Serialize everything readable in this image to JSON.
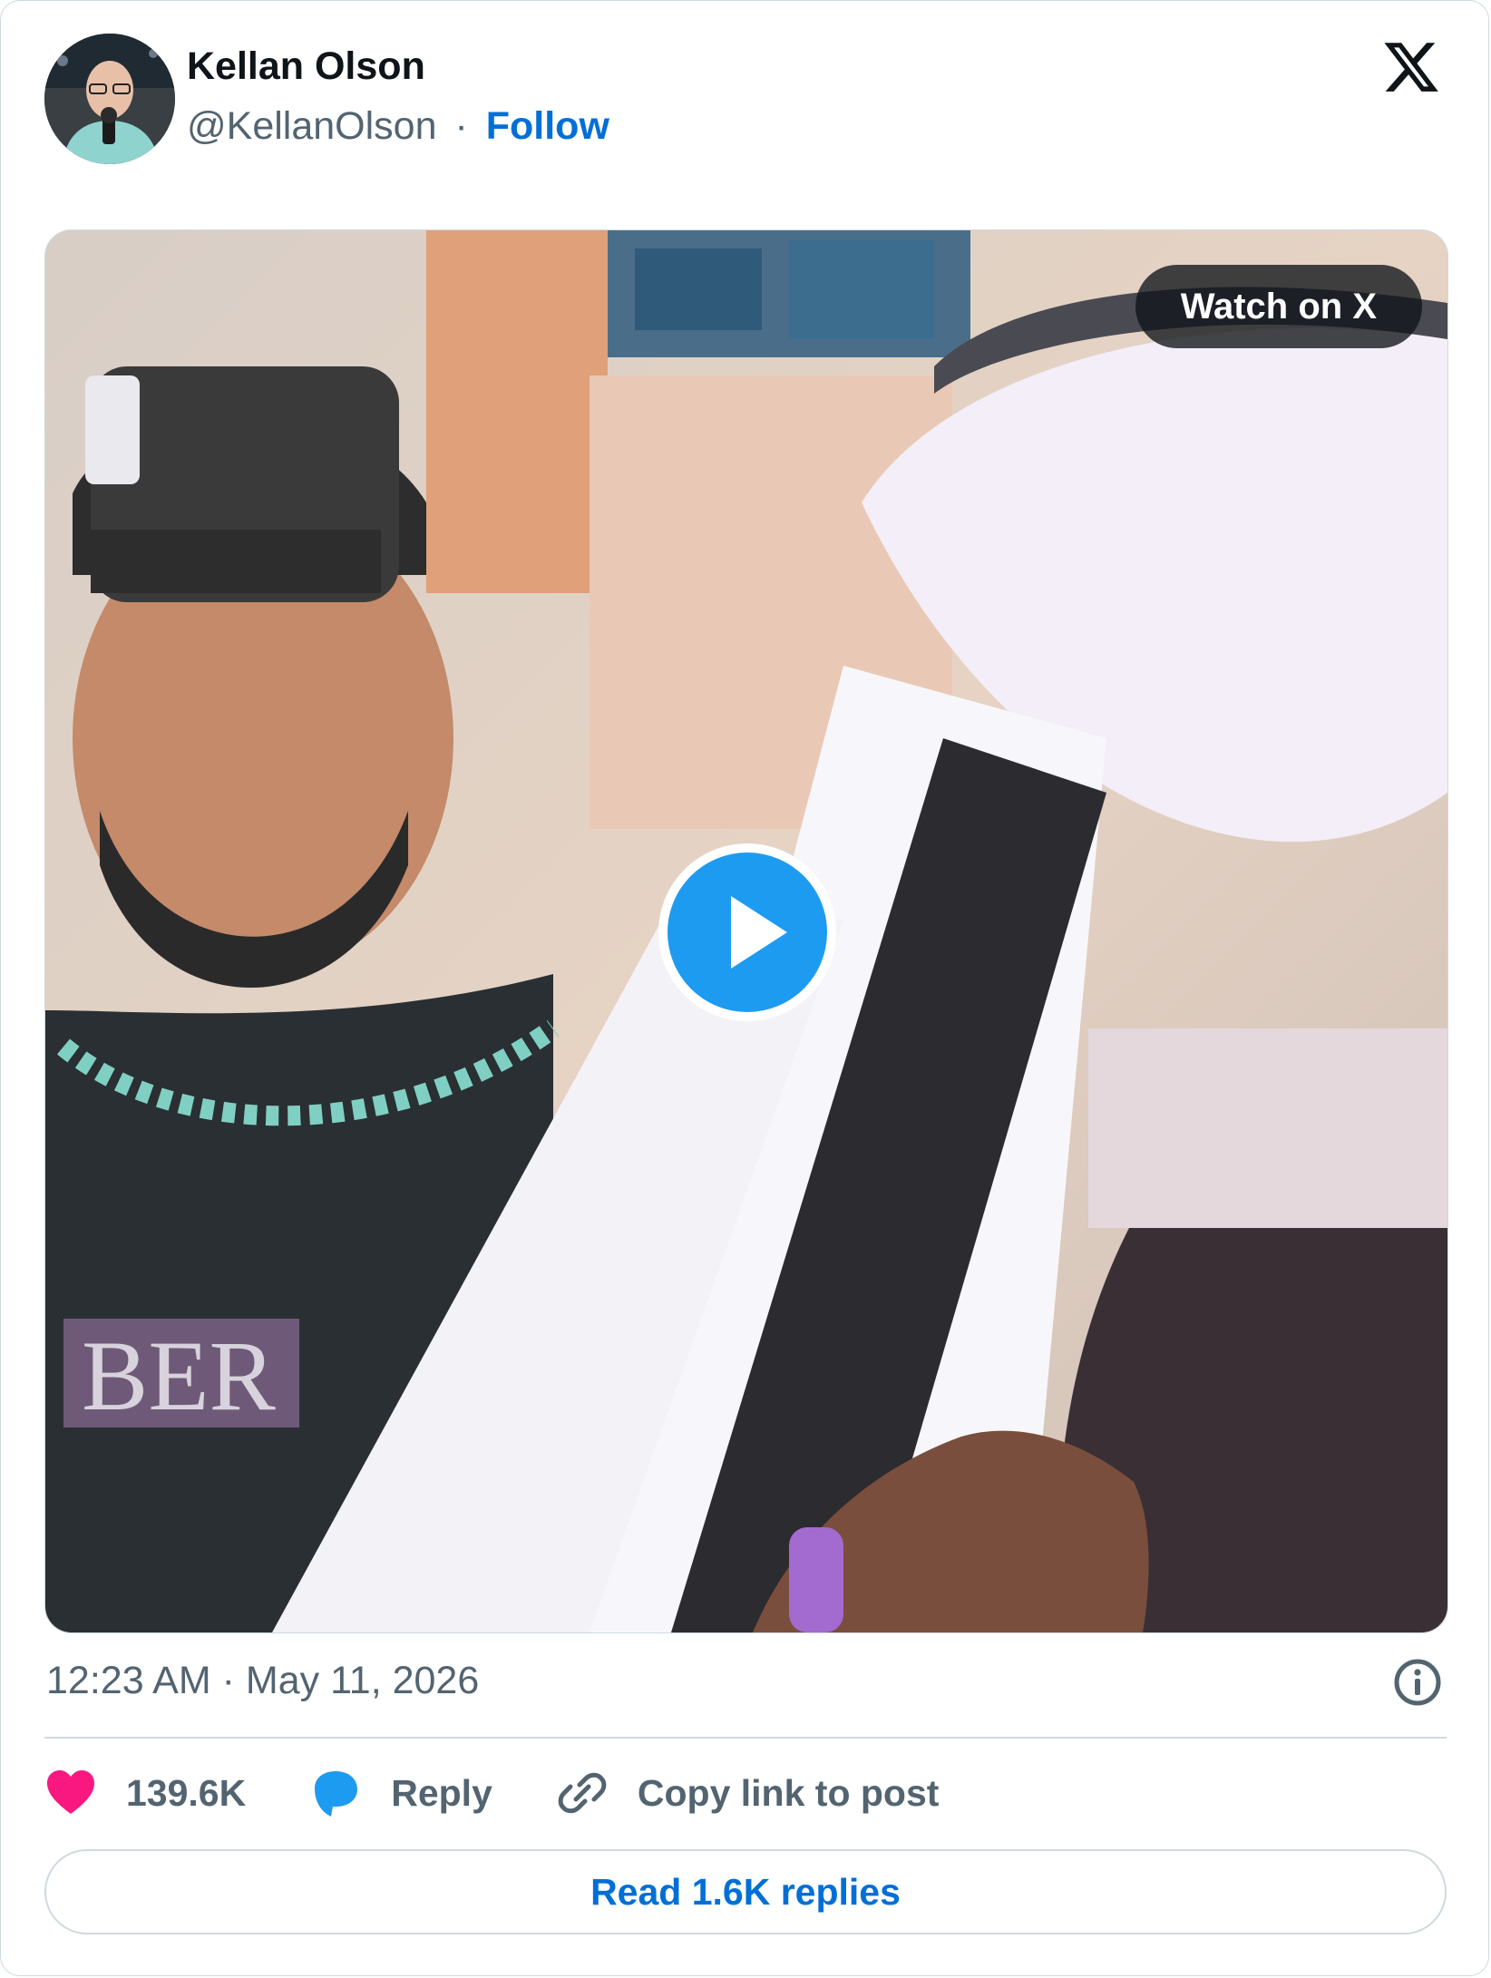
{
  "author": {
    "name": "Kellan Olson",
    "handle": "@KellanOlson",
    "separator": "·",
    "follow_label": "Follow"
  },
  "media": {
    "watch_label": "Watch on X",
    "type": "video"
  },
  "post": {
    "timestamp": "12:23 AM · May 11, 2026"
  },
  "actions": {
    "likes_count": "139.6K",
    "reply_label": "Reply",
    "copy_link_label": "Copy link to post"
  },
  "footer": {
    "read_replies_label": "Read 1.6K replies"
  },
  "icons": {
    "brand": "x-logo-icon",
    "like": "heart-icon",
    "reply": "speech-bubble-icon",
    "copy": "link-icon",
    "info": "info-icon",
    "play": "play-icon"
  },
  "colors": {
    "accent_blue": "#006fd6",
    "play_blue": "#1d9bf0",
    "like_pink": "#f91880",
    "text_secondary": "#536471",
    "text_primary": "#0f1419",
    "border": "#cfd9de"
  }
}
